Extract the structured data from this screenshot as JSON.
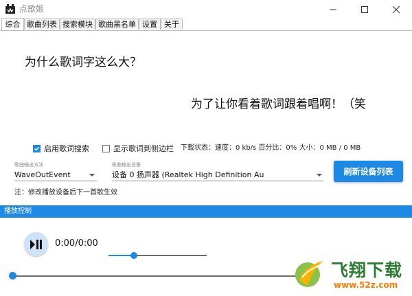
{
  "window": {
    "title": "点歌姬"
  },
  "tabs": [
    {
      "label": "综合",
      "active": true
    },
    {
      "label": "歌曲列表",
      "active": false
    },
    {
      "label": "搜索模块",
      "active": false
    },
    {
      "label": "歌曲黑名单",
      "active": false
    },
    {
      "label": "设置",
      "active": false
    },
    {
      "label": "关于",
      "active": false
    }
  ],
  "lyrics": {
    "line1": "为什么歌词字这么大？",
    "line2": "为了让你看着歌词跟着唱啊！（笑"
  },
  "options": {
    "enable_lyric_search": {
      "label": "启用歌词搜索",
      "checked": true
    },
    "show_lyric_side": {
      "label": "显示歌词到侧边栏",
      "checked": false
    }
  },
  "download_status": "下载状态：速度：0 kb/s 百分比：0% 大小：0 MB / 0 MB",
  "output_method": {
    "label": "歌曲输出方法",
    "value": "WaveOutEvent"
  },
  "output_device": {
    "label": "歌曲输出设备",
    "value": "设备 0  扬声器 (Realtek High Definition Au"
  },
  "refresh_button_label": "刷新设备列表",
  "note": "注：修改播放设备后下一首歌生效",
  "playback": {
    "section_title": "播放控制",
    "time": "0:00/0:00",
    "volume_fraction": 0.26,
    "progress_fraction": 0.0
  },
  "watermark": {
    "brand": "飞翔下载",
    "url": "www.52z.com"
  },
  "colors": {
    "accent": "#1e88e5",
    "brand_green": "#2e7d32",
    "brand_orange": "#ff7a00"
  }
}
